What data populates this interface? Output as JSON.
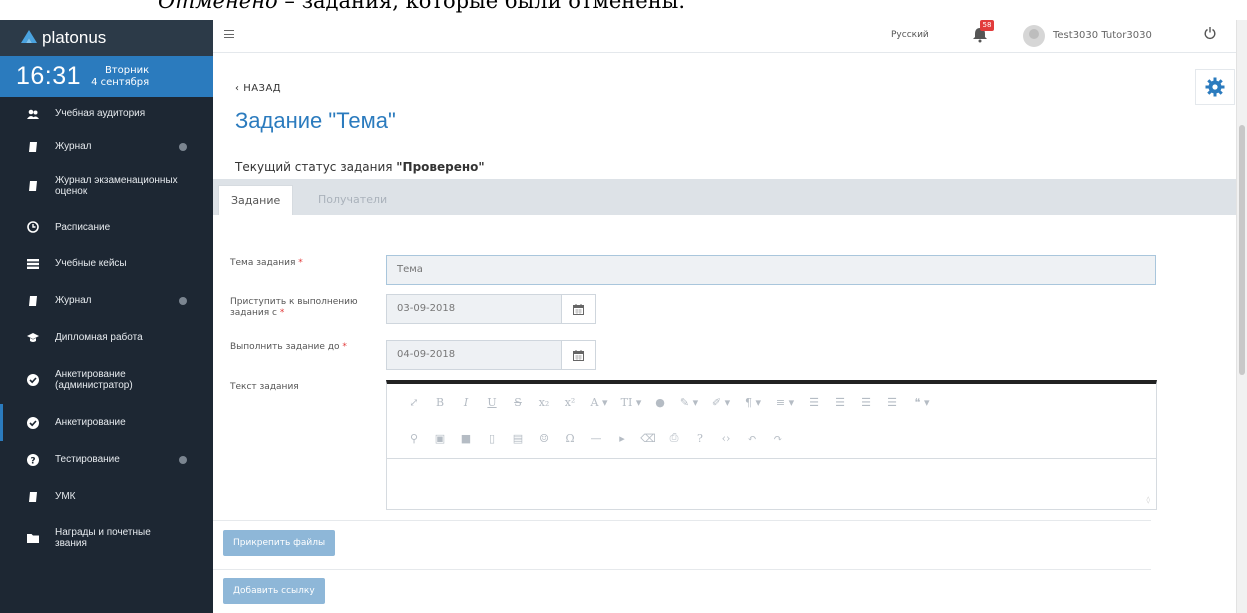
{
  "doc_caption": {
    "italic": "Отменено",
    "rest": " – задания, которые были отменены."
  },
  "app": {
    "logo": "platonus"
  },
  "clock": {
    "time": "16:31",
    "weekday": "Вторник",
    "date": "4 сентября"
  },
  "sidebar": {
    "items": [
      {
        "label": "Учебная аудитория",
        "icon": "users-icon",
        "chevron": false
      },
      {
        "label": "Журнал",
        "icon": "book-icon",
        "chevron": true
      },
      {
        "label": "Журнал экзаменационных оценок",
        "icon": "book-icon",
        "chevron": false
      },
      {
        "label": "Расписание",
        "icon": "clock-icon",
        "chevron": false
      },
      {
        "label": "Учебные кейсы",
        "icon": "list-icon",
        "chevron": false
      },
      {
        "label": "Журнал",
        "icon": "book-icon",
        "chevron": true
      },
      {
        "label": "Дипломная работа",
        "icon": "graduation-cap-icon",
        "chevron": false
      },
      {
        "label": "Анкетирование (администратор)",
        "icon": "check-circle-icon",
        "chevron": false
      },
      {
        "label": "Анкетирование",
        "icon": "check-circle-icon",
        "chevron": false
      },
      {
        "label": "Тестирование",
        "icon": "question-circle-icon",
        "chevron": true
      },
      {
        "label": "УМК",
        "icon": "book-icon",
        "chevron": false
      },
      {
        "label": "Награды и почетные звания",
        "icon": "folder-icon",
        "chevron": false
      }
    ]
  },
  "header": {
    "language": "Русский",
    "notifications": "58",
    "user": "Test3030 Tutor3030"
  },
  "main": {
    "back": "НАЗАД",
    "title": "Задание \"Тема\"",
    "status_prefix": "Текущий статус задания ",
    "status_value": "\"Проверено\"",
    "tabs": [
      {
        "label": "Задание"
      },
      {
        "label": "Получатели"
      }
    ],
    "form": {
      "topic_label": "Тема задания",
      "topic_value": "Тема",
      "start_label": "Приступить к выполнению задания с",
      "start_value": "03-09-2018",
      "due_label": "Выполнить задание до",
      "due_value": "04-09-2018",
      "text_label": "Текст задания",
      "required_mark": "*"
    },
    "attach_button": "Прикрепить файлы",
    "link_button": "Добавить ссылку"
  },
  "colors": {
    "accent": "#2b7bbe",
    "sidebar": "#1d2733",
    "badge": "#e23b3b"
  }
}
